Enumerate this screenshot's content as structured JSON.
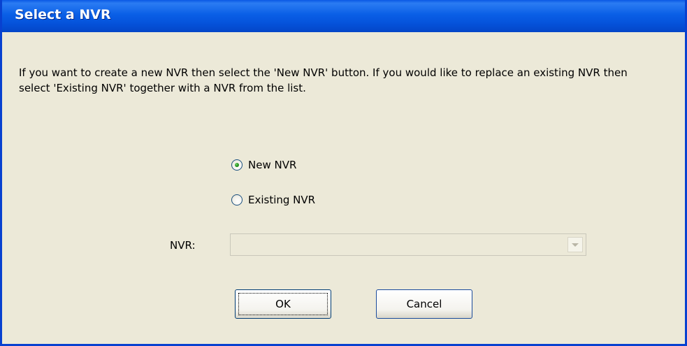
{
  "window": {
    "title": "Select a NVR"
  },
  "instruction": "If you want to create a new NVR then select the 'New NVR' button. If you would like to replace an existing NVR then select 'Existing NVR' together with a NVR from the list.",
  "options": {
    "new_nvr": {
      "label": "New NVR",
      "selected": true
    },
    "existing_nvr": {
      "label": "Existing NVR",
      "selected": false
    }
  },
  "nvr_select": {
    "label": "NVR:",
    "value": "",
    "disabled": true
  },
  "buttons": {
    "ok": "OK",
    "cancel": "Cancel"
  },
  "colors": {
    "titlebar": "#0a5fe6",
    "dialog_bg": "#ece9d8",
    "button_border": "#003c74"
  }
}
